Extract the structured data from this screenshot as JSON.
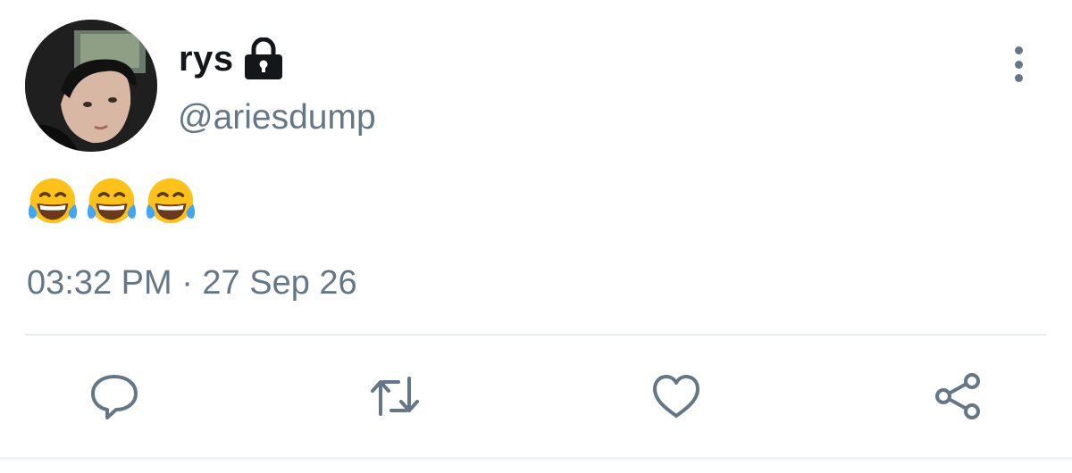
{
  "user": {
    "display_name": "rys",
    "handle": "@ariesdump",
    "protected_icon": "lock-icon",
    "avatar_icon": "avatar"
  },
  "tweet": {
    "text": "😂😂😂",
    "emoji_icon": "face-with-tears-of-joy-icon",
    "emoji_count": 3,
    "timestamp": "03:32 PM · 27 Sep 26"
  },
  "actions": [
    {
      "name": "reply",
      "icon": "reply-icon"
    },
    {
      "name": "retweet",
      "icon": "retweet-icon"
    },
    {
      "name": "like",
      "icon": "heart-icon"
    },
    {
      "name": "share",
      "icon": "share-icon"
    }
  ],
  "menu": {
    "icon": "more-vertical-icon"
  },
  "colors": {
    "primary_text": "#14171a",
    "secondary_text": "#657786",
    "divider": "#e6ecf0",
    "background": "#ffffff"
  }
}
